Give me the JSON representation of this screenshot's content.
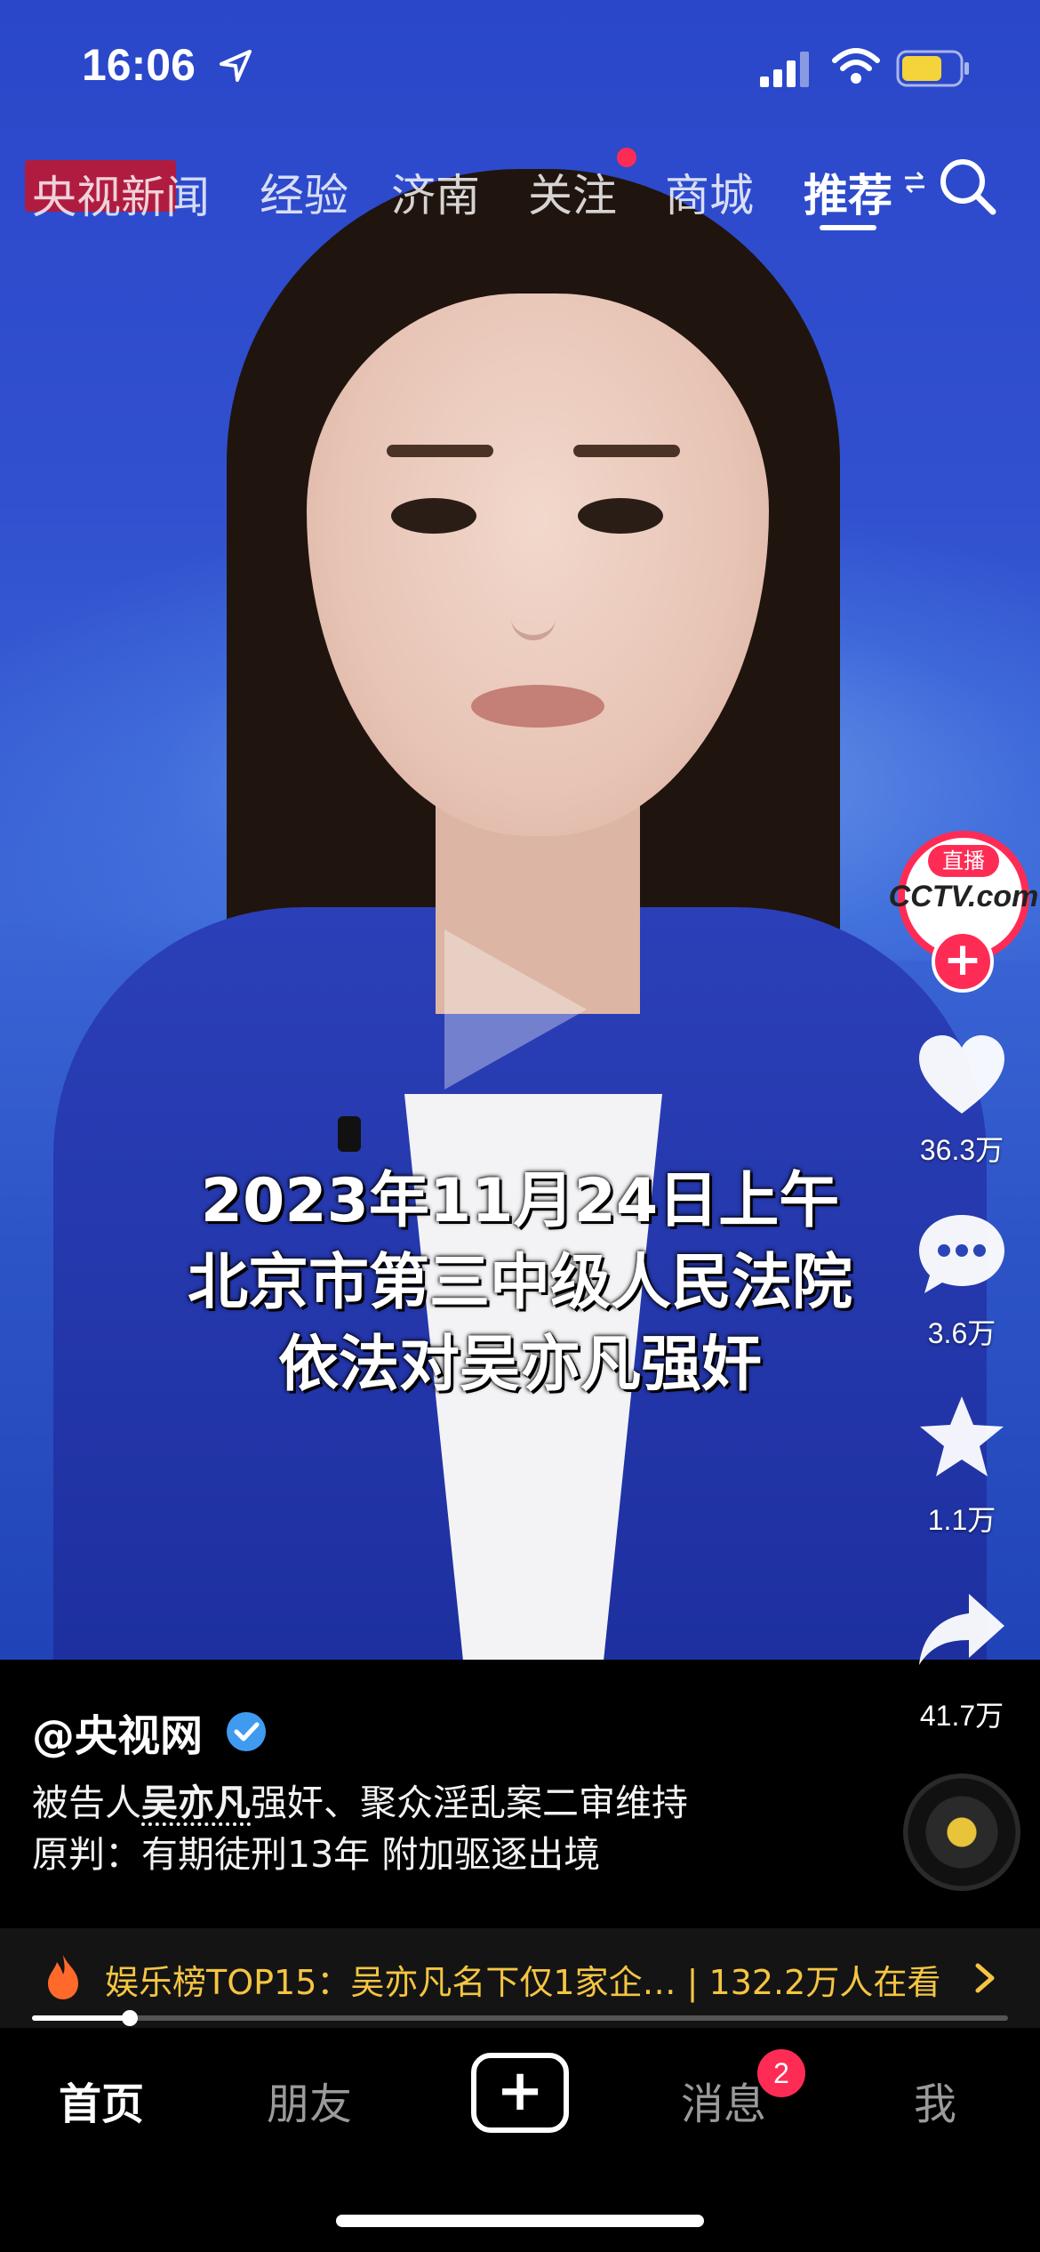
{
  "status_bar": {
    "time": "16:06",
    "icons": [
      "location-arrow-icon",
      "cellular-signal-icon",
      "wifi-icon",
      "battery-icon"
    ],
    "battery_color": "#f5d33a"
  },
  "top_nav": {
    "overlay_logo": "央视新闻",
    "tabs": [
      {
        "label": "经验",
        "active": false
      },
      {
        "label": "济南",
        "active": false
      },
      {
        "label": "关注",
        "active": false,
        "has_dot": true
      },
      {
        "label": "商城",
        "active": false
      },
      {
        "label": "推荐",
        "active": true
      }
    ],
    "search_icon": "search-icon"
  },
  "video": {
    "subtitle_lines": [
      "2023年11月24日上午",
      "北京市第三中级人民法院",
      "依法对吴亦凡强奸"
    ],
    "play_icon": "play-icon"
  },
  "actions": {
    "live_badge": "直播",
    "avatar_logo": "CCTV.com",
    "like_count": "36.3万",
    "comment_count": "3.6万",
    "favorite_count": "1.1万",
    "share_count": "41.7万"
  },
  "post": {
    "author": "@央视网",
    "desc_prefix": "被告人",
    "desc_mention": "吴亦凡",
    "desc_line1_rest": "强奸、聚众淫乱案二审维持",
    "desc_line2": "原判：有期徒刑13年 附加驱逐出境"
  },
  "trending": {
    "text": "娱乐榜TOP15：吴亦凡名下仅1家企…  | 132.2万人在看",
    "color": "#f5c542"
  },
  "playback": {
    "progress": 0.1
  },
  "tab_bar": {
    "home": "首页",
    "friends": "朋友",
    "create": "+",
    "messages": "消息",
    "messages_badge": "2",
    "me": "我"
  },
  "colors": {
    "accent": "#fe2c55",
    "verified": "#3f9bf0"
  }
}
